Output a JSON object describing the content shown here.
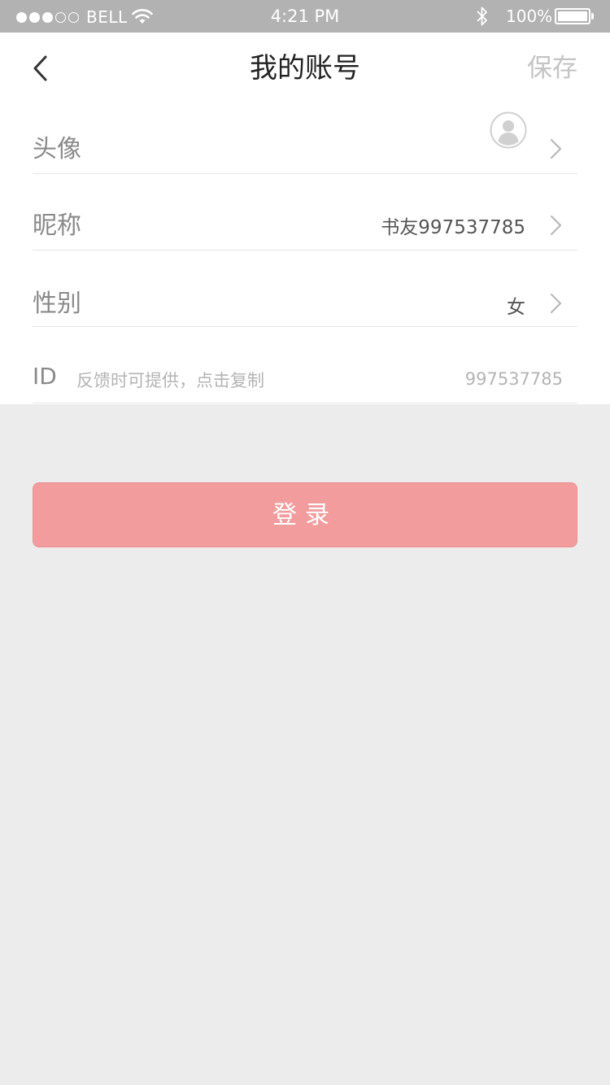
{
  "status_bar": {
    "carrier": "BELL",
    "time": "4:21 PM",
    "battery_percent": "100%",
    "signal_bars_filled": 3,
    "signal_bars_total": 5
  },
  "nav": {
    "back_icon": "chevron-left-icon",
    "title": "我的账号",
    "save_label": "保存"
  },
  "rows": {
    "avatar": {
      "label": "头像",
      "icon": "user-avatar-icon"
    },
    "nickname": {
      "label": "昵称",
      "value": "书友997537785"
    },
    "gender": {
      "label": "性别",
      "value": "女"
    },
    "id": {
      "label": "ID",
      "hint": "反馈时可提供，点击复制",
      "value": "997537785"
    }
  },
  "login_button": {
    "label": "登录"
  },
  "colors": {
    "status_bar_bg": "#b2b2b2",
    "button_bg": "#f29c9d",
    "page_bg": "#ececec"
  }
}
